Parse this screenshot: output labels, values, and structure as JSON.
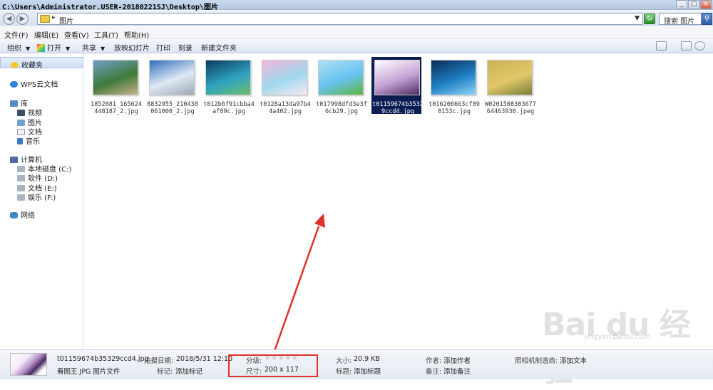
{
  "window": {
    "title": "C:\\Users\\Administrator.USER-20180221SJ\\Desktop\\图片"
  },
  "address": {
    "path": "图片",
    "search_placeholder": "搜索 图片"
  },
  "menu": [
    "文件(F)",
    "编辑(E)",
    "查看(V)",
    "工具(T)",
    "帮助(H)"
  ],
  "toolbar": {
    "organize": "组织",
    "open": "打开",
    "share": "共享",
    "slideshow": "放映幻灯片",
    "print": "打印",
    "burn": "刻录",
    "new_folder": "新建文件夹"
  },
  "nav": {
    "favorites": "收藏夹",
    "wps": "WPS云文档",
    "library": "库",
    "library_items": [
      "视频",
      "图片",
      "文档",
      "音乐"
    ],
    "computer": "计算机",
    "drives": [
      "本地磁盘 (C:)",
      "软件 (D:)",
      "文档 (E:)",
      "娱乐 (F:)"
    ],
    "network": "网络"
  },
  "files": [
    {
      "name": "1852081_165624448187_2.jpg",
      "colors": [
        "#6f9fc9",
        "#3f7a3a",
        "#c9b08a"
      ]
    },
    {
      "name": "8832955_210438061000_2.jpg",
      "colors": [
        "#2f6fc0",
        "#dfe9f3",
        "#9aa7b4"
      ]
    },
    {
      "name": "t012b6f91cbba4af89c.jpg",
      "colors": [
        "#0c3b5a",
        "#2fa3c2",
        "#6cbc6a"
      ]
    },
    {
      "name": "t0128a13da97b44a402.jpg",
      "colors": [
        "#f3b6d8",
        "#9fd9ee",
        "#f7e8f1"
      ]
    },
    {
      "name": "t017998dfd3e3f6cb29.jpg",
      "colors": [
        "#aee0f7",
        "#67c2ee",
        "#5cb83c"
      ]
    },
    {
      "name": "t01159674b35329ccd4.jpg",
      "colors": [
        "#ffffff",
        "#c6a3d6",
        "#4a2b63"
      ]
    },
    {
      "name": "t016206663cf890153c.jpg",
      "colors": [
        "#0a2c57",
        "#1f7fc4",
        "#8fd4f5"
      ]
    },
    {
      "name": "W020150830367764463930.jpeg",
      "colors": [
        "#c9b050",
        "#e2c86a",
        "#7a7d3a"
      ]
    }
  ],
  "selected_index": 5,
  "status": {
    "filename": "t01159674b35329ccd4.jpg",
    "filetype": "看图王 JPG 图片文件",
    "date_label": "拍摄日期:",
    "date": "2018/5/31 12:10",
    "tags_label": "标记:",
    "tags": "添加标记",
    "rating_label": "分级:",
    "size_dims_label": "尺寸:",
    "size_dims": "200 x 117",
    "filesize_label": "大小:",
    "filesize": "20.9 KB",
    "title_label": "标题:",
    "title": "添加标题",
    "author_label": "作者:",
    "author": "添加作者",
    "comments_label": "备注:",
    "comments": "添加备注",
    "camera_label": "照相机制造商:",
    "camera": "添加文本"
  },
  "watermark": {
    "brand": "Bai du 经验",
    "url": "jingyan.baidu.com"
  }
}
